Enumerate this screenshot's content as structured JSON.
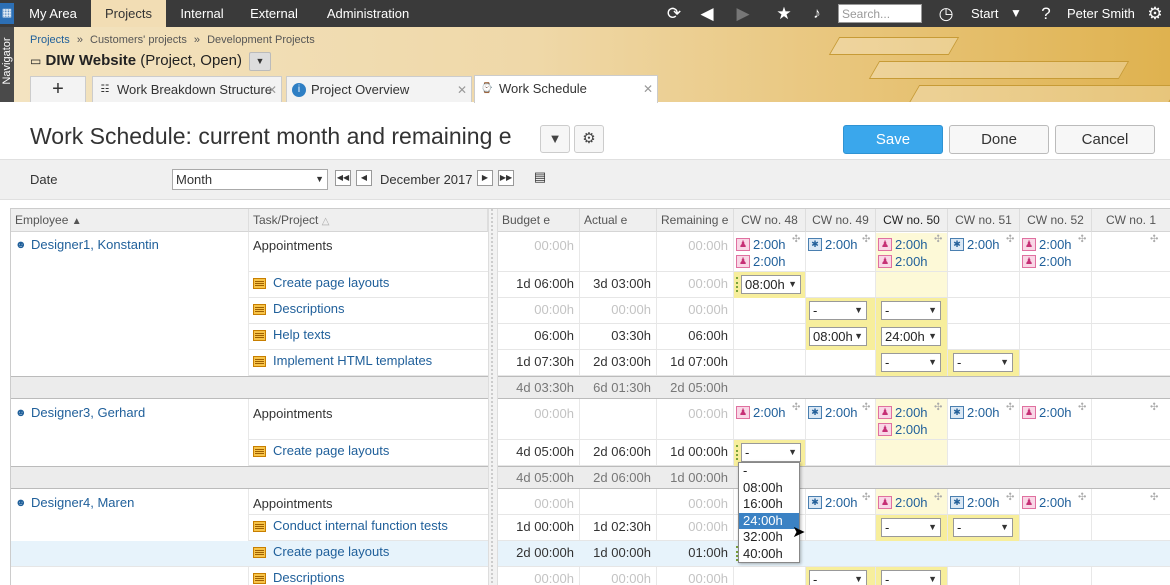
{
  "topbar": {
    "nav": [
      "My Area",
      "Projects",
      "Internal",
      "External",
      "Administration"
    ],
    "search_placeholder": "Search...",
    "start_label": "Start",
    "user": "Peter Smith",
    "icons": [
      "refresh-icon",
      "back-icon",
      "forward-icon",
      "star-icon",
      "bell-icon",
      "timer-icon",
      "help-icon",
      "gear-icon"
    ]
  },
  "navigator": "Navigator",
  "project": {
    "breadcrumb": [
      "Projects",
      "»",
      "Customers' projects",
      "»",
      "Development Projects"
    ],
    "name": "DIW Website",
    "status": "(Project, Open)"
  },
  "tabs": [
    {
      "label": "Work Breakdown Structure",
      "icon": "wbs-icon"
    },
    {
      "label": "Project Overview",
      "icon": "info-icon"
    },
    {
      "label": "Work Schedule",
      "icon": "schedule-icon"
    }
  ],
  "page": {
    "title": "Work Schedule: current month and remaining e",
    "save": "Save",
    "done": "Done",
    "cancel": "Cancel"
  },
  "filter": {
    "label": "Date",
    "period": "Month",
    "value": "December 2017"
  },
  "columns": {
    "employee": "Employee",
    "task": "Task/Project",
    "budget": "Budget e",
    "actual": "Actual e",
    "remaining": "Remaining e",
    "weeks": [
      "CW no. 48",
      "CW no. 49",
      "CW no. 50",
      "CW no. 51",
      "CW no. 52",
      "CW no. 1"
    ]
  },
  "rows": {
    "d1": {
      "employee": "Designer1, Konstantin",
      "appointments": {
        "task": "Appointments",
        "budget": "00:00h",
        "remaining": "00:00h",
        "w48": [
          "2:00h",
          "2:00h"
        ],
        "w49": [
          "2:00h"
        ],
        "w50": [
          "2:00h",
          "2:00h"
        ],
        "w51": [
          "2:00h"
        ],
        "w52": [
          "2:00h",
          "2:00h"
        ]
      },
      "t1": {
        "task": "Create page layouts",
        "budget": "1d 06:00h",
        "actual": "3d 03:00h",
        "remaining": "00:00h",
        "w48": "08:00h"
      },
      "t2": {
        "task": "Descriptions",
        "budget": "00:00h",
        "actual": "00:00h",
        "remaining": "00:00h",
        "w49": "-",
        "w50": "-"
      },
      "t3": {
        "task": "Help texts",
        "budget": "06:00h",
        "actual": "03:30h",
        "remaining": "06:00h",
        "w49": "08:00h",
        "w50": "24:00h"
      },
      "t4": {
        "task": "Implement HTML templates",
        "budget": "1d 07:30h",
        "actual": "2d 03:00h",
        "remaining": "1d 07:00h",
        "w50": "-",
        "w51": "-"
      },
      "subtotal": {
        "budget": "4d 03:30h",
        "actual": "6d 01:30h",
        "remaining": "2d 05:00h"
      }
    },
    "d3": {
      "employee": "Designer3, Gerhard",
      "appointments": {
        "task": "Appointments",
        "budget": "00:00h",
        "remaining": "00:00h",
        "w48": [
          "2:00h"
        ],
        "w49": [
          "2:00h"
        ],
        "w50": [
          "2:00h",
          "2:00h"
        ],
        "w51": [
          "2:00h"
        ],
        "w52": [
          "2:00h"
        ]
      },
      "t1": {
        "task": "Create page layouts",
        "budget": "4d 05:00h",
        "actual": "2d 06:00h",
        "remaining": "1d 00:00h",
        "w48": "-"
      },
      "subtotal": {
        "budget": "4d 05:00h",
        "actual": "2d 06:00h",
        "remaining": "1d 00:00h"
      }
    },
    "d4": {
      "employee": "Designer4, Maren",
      "appointments": {
        "task": "Appointments",
        "budget": "00:00h",
        "remaining": "00:00h",
        "w49": [
          "2:00h"
        ],
        "w50": [
          "2:00h"
        ],
        "w51": [
          "2:00h"
        ],
        "w52": [
          "2:00h"
        ]
      },
      "t1": {
        "task": "Conduct internal function tests",
        "budget": "1d 00:00h",
        "actual": "1d 02:30h",
        "remaining": "00:00h",
        "w50": "-",
        "w51": "-"
      },
      "t2": {
        "task": "Create page layouts",
        "budget": "2d 00:00h",
        "actual": "1d 00:00h",
        "remaining": "01:00h"
      },
      "t3": {
        "task": "Descriptions",
        "budget": "00:00h",
        "actual": "00:00h",
        "remaining": "00:00h",
        "w49": "-",
        "w50": "-"
      }
    }
  },
  "dropdown": {
    "options": [
      "-",
      "08:00h",
      "16:00h",
      "24:00h",
      "32:00h",
      "40:00h"
    ],
    "highlighted": "24:00h"
  }
}
